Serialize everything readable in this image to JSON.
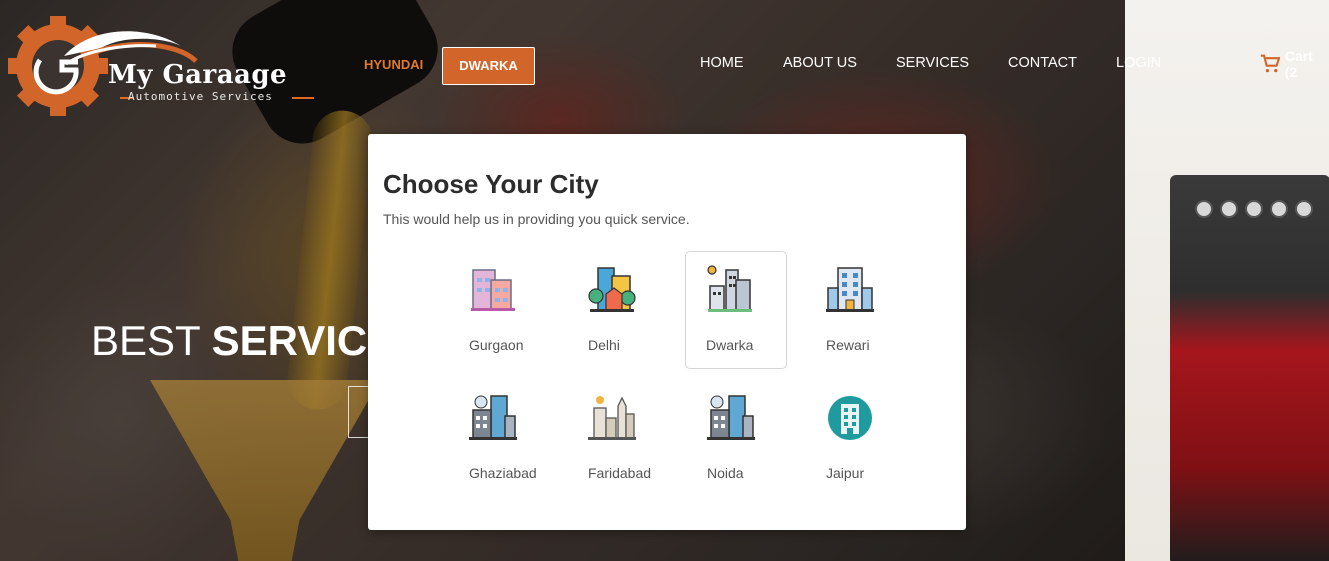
{
  "brand": {
    "name": "My Garaage",
    "tagline": "Automotive Services"
  },
  "header": {
    "brand_selection": "HYUNDAI",
    "city_button": "DWARKA",
    "nav": [
      "HOME",
      "ABOUT US",
      "SERVICES",
      "CONTACT",
      "LOGIN"
    ],
    "cart_label": "Cart (2"
  },
  "hero": {
    "title_regular": "BEST ",
    "title_bold": "SERVIC"
  },
  "modal": {
    "title": "Choose Your City",
    "subtitle": "This would help us in providing you quick service.",
    "selected_city": "Dwarka",
    "cities": [
      {
        "name": "Gurgaon",
        "icon": "gurgaon-icon"
      },
      {
        "name": "Delhi",
        "icon": "delhi-icon"
      },
      {
        "name": "Dwarka",
        "icon": "dwarka-icon"
      },
      {
        "name": "Rewari",
        "icon": "rewari-icon"
      },
      {
        "name": "Ghaziabad",
        "icon": "ghaziabad-icon"
      },
      {
        "name": "Faridabad",
        "icon": "faridabad-icon"
      },
      {
        "name": "Noida",
        "icon": "noida-icon"
      },
      {
        "name": "Jaipur",
        "icon": "jaipur-icon"
      }
    ]
  },
  "colors": {
    "accent": "#d2652a",
    "brand_orange": "#e07a2f"
  }
}
